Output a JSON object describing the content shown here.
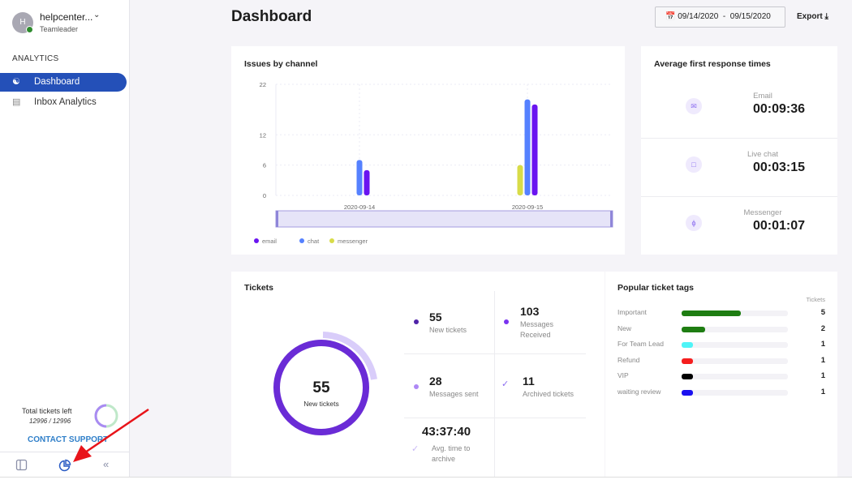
{
  "user": {
    "initial": "H",
    "name": "helpcenter...",
    "role": "Teamleader"
  },
  "sidebar": {
    "section": "ANALYTICS",
    "items": [
      {
        "label": "Dashboard",
        "icon": "users-icon",
        "active": true
      },
      {
        "label": "Inbox Analytics",
        "icon": "inbox-icon",
        "active": false
      }
    ],
    "tickets_left_label": "Total tickets left",
    "tickets_left_value": "12996 / 12996",
    "contact": "CONTACT SUPPORT"
  },
  "header": {
    "title": "Dashboard",
    "date_from": "09/14/2020",
    "date_sep": "-",
    "date_to": "09/15/2020",
    "export": "Export"
  },
  "issues": {
    "title": "Issues by channel"
  },
  "chart_data": {
    "type": "bar",
    "title": "Issues by channel",
    "categories": [
      "2020-09-14",
      "2020-09-15"
    ],
    "yticks": [
      0,
      6,
      12,
      22
    ],
    "ylim": [
      0,
      22
    ],
    "grid": true,
    "legend": "bottom-left",
    "series": [
      {
        "name": "email",
        "color": "#6a14f0",
        "values": [
          5,
          18
        ]
      },
      {
        "name": "chat",
        "color": "#5581ff",
        "values": [
          7,
          19
        ]
      },
      {
        "name": "messenger",
        "color": "#d8dc48",
        "values": [
          0,
          6
        ]
      }
    ]
  },
  "response": {
    "title": "Average first response times",
    "items": [
      {
        "label": "Email",
        "value": "00:09:36",
        "icon": "mail-icon"
      },
      {
        "label": "Live chat",
        "value": "00:03:15",
        "icon": "chat-icon"
      },
      {
        "label": "Messenger",
        "value": "00:01:07",
        "icon": "messenger-icon"
      }
    ]
  },
  "tickets": {
    "title": "Tickets",
    "donut_value": "55",
    "donut_label": "New tickets",
    "stats": [
      {
        "value": "55",
        "label": "New tickets"
      },
      {
        "value": "103",
        "label": "Messages Received"
      },
      {
        "value": "28",
        "label": "Messages sent"
      },
      {
        "value": "11",
        "label": "Archived tickets"
      },
      {
        "value": "43:37:40",
        "label": "Avg. time to archive"
      }
    ]
  },
  "tags": {
    "title": "Popular ticket tags",
    "col": "Tickets",
    "items": [
      {
        "name": "Important",
        "count": "5",
        "color": "#1e7d12"
      },
      {
        "name": "New",
        "count": "2",
        "color": "#1e7d12"
      },
      {
        "name": "For Team Lead",
        "count": "1",
        "color": "#4ef4f7"
      },
      {
        "name": " Refund",
        "count": "1",
        "color": "#f51e1e"
      },
      {
        "name": "VIP",
        "count": "1",
        "color": "#000000"
      },
      {
        "name": "waiting review",
        "count": "1",
        "color": "#1a10f0"
      }
    ]
  }
}
